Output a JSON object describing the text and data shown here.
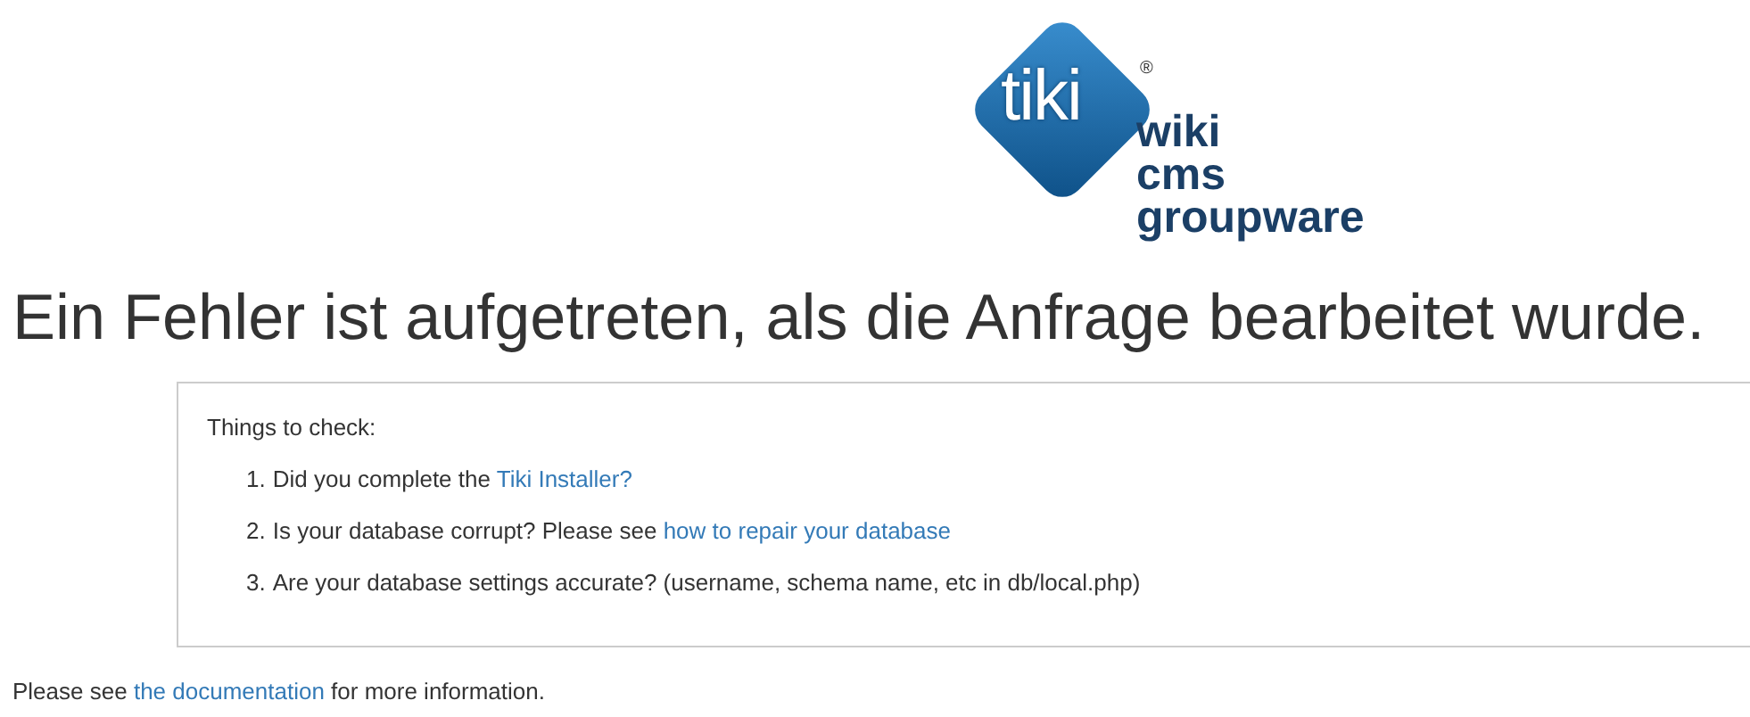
{
  "logo": {
    "mark": "tiki",
    "registered": "®",
    "lines": [
      "wiki",
      "cms",
      "groupware"
    ]
  },
  "heading": "Ein Fehler ist aufgetreten, als die Anfrage bearbeitet wurde.",
  "panel": {
    "title": "Things to check:",
    "items": [
      {
        "number": "1.",
        "text": "Did you complete the",
        "link": "Tiki Installer?"
      },
      {
        "number": "2.",
        "text": "Is your database corrupt? Please see",
        "link": "how to repair your database"
      },
      {
        "number": "3.",
        "text": "Are your database settings accurate? (username, schema name, etc in db/local.php)"
      }
    ]
  },
  "footer": {
    "before": "Please see",
    "link": "the documentation",
    "after": "for more information."
  }
}
